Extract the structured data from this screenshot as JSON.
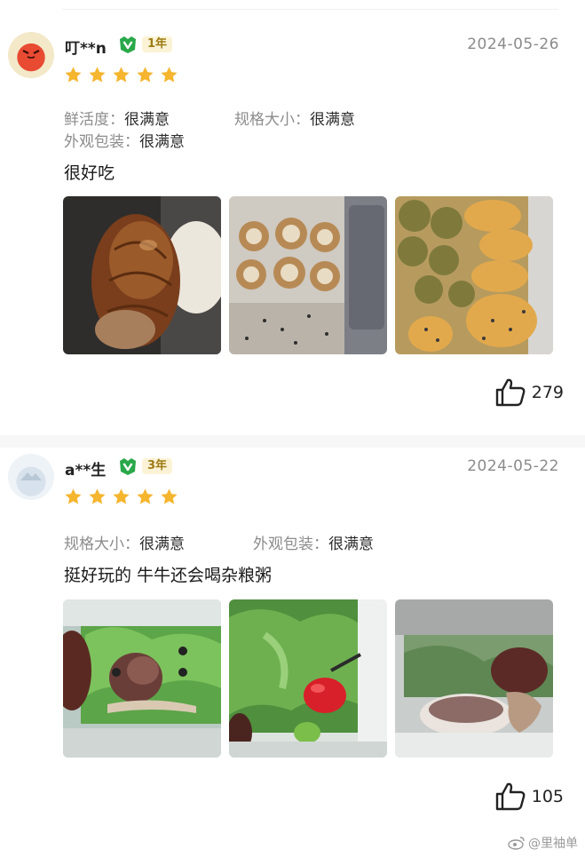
{
  "reviews": [
    {
      "username": "叮**n",
      "membership_years": "1年",
      "date": "2024-05-26",
      "rating_stars": 5,
      "specs": [
        {
          "key": "鲜活度：",
          "value": "很满意"
        },
        {
          "key": "规格大小：",
          "value": "很满意"
        },
        {
          "key": "外观包装：",
          "value": "很满意"
        }
      ],
      "comment": "很好吃",
      "photos": [
        "snail-closeup-photo",
        "cooked-snails-tray-photo",
        "baked-snail-dish-photo"
      ],
      "likes": "279"
    },
    {
      "username": "a**生",
      "membership_years": "3年",
      "date": "2024-05-22",
      "rating_stars": 5,
      "specs": [
        {
          "key": "规格大小：",
          "value": "很满意"
        },
        {
          "key": "外观包装：",
          "value": "很满意"
        }
      ],
      "comment": "挺好玩的 牛牛还会喝杂粮粥",
      "photos": [
        "snail-in-tank-photo",
        "snail-with-strawberry-photo",
        "snail-eating-porridge-photo"
      ],
      "likes": "105"
    }
  ],
  "watermark": "@里袖单",
  "colors": {
    "star": "#f5b52e",
    "vip_green": "#2aa84a",
    "year_tag_bg": "#fcf3d6",
    "year_tag_text": "#9e7b15",
    "date_gray": "#8b8b8b",
    "spec_key_gray": "#8c8c8c"
  }
}
